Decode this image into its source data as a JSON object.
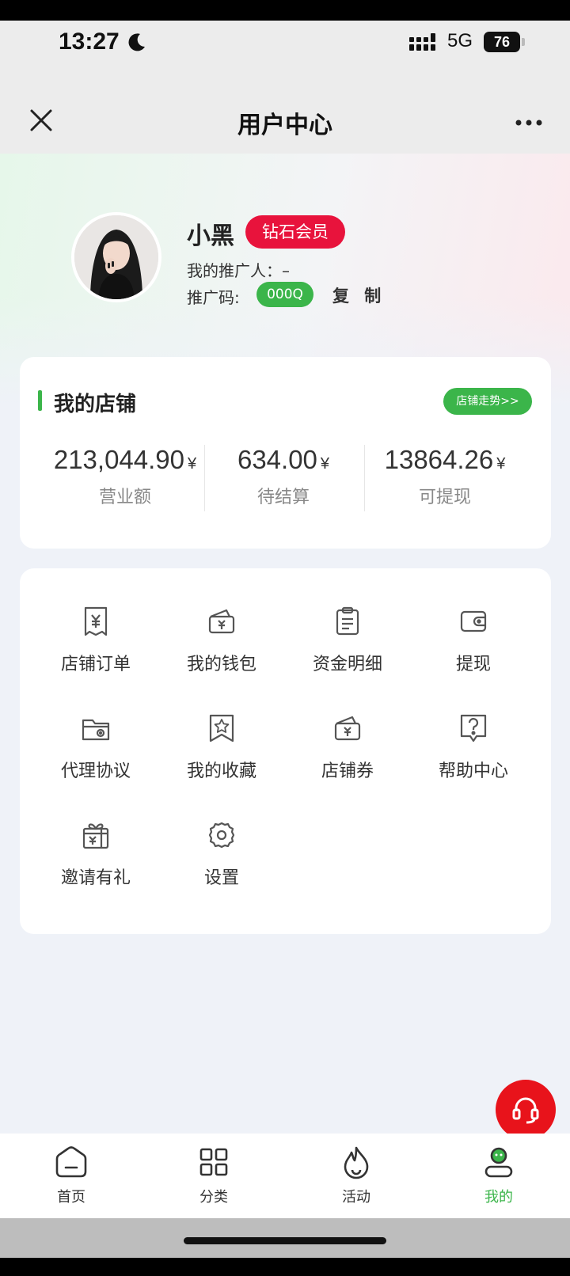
{
  "status_bar": {
    "time": "13:27",
    "network": "5G",
    "battery": "76"
  },
  "nav": {
    "title": "用户中心"
  },
  "profile": {
    "name": "小黑",
    "badge": "钻石会员",
    "promoter_label": "我的推广人：–",
    "promo_code_label": "推广码:",
    "promo_code": "000Q",
    "copy_label": "复 制"
  },
  "shop": {
    "title": "我的店铺",
    "trend_button": "店铺走势>>",
    "stats": [
      {
        "value": "213,044.90",
        "unit": "¥",
        "label": "营业额"
      },
      {
        "value": "634.00",
        "unit": "¥",
        "label": "待结算"
      },
      {
        "value": "13864.26",
        "unit": "¥",
        "label": "可提现"
      }
    ]
  },
  "menu": {
    "items": [
      {
        "label": "店铺订单",
        "icon": "receipt-yen-icon"
      },
      {
        "label": "我的钱包",
        "icon": "wallet-yen-icon"
      },
      {
        "label": "资金明细",
        "icon": "clipboard-icon"
      },
      {
        "label": "提现",
        "icon": "wallet-icon"
      },
      {
        "label": "代理协议",
        "icon": "folder-icon"
      },
      {
        "label": "我的收藏",
        "icon": "star-bookmark-icon"
      },
      {
        "label": "店铺券",
        "icon": "coupon-icon"
      },
      {
        "label": "帮助中心",
        "icon": "help-icon"
      },
      {
        "label": "邀请有礼",
        "icon": "gift-icon"
      },
      {
        "label": "设置",
        "icon": "gear-icon"
      }
    ]
  },
  "tabbar": {
    "tabs": [
      {
        "label": "首页",
        "icon": "home-icon",
        "active": false
      },
      {
        "label": "分类",
        "icon": "grid-icon",
        "active": false
      },
      {
        "label": "活动",
        "icon": "flame-icon",
        "active": false
      },
      {
        "label": "我的",
        "icon": "user-icon",
        "active": true
      }
    ]
  },
  "colors": {
    "accent": "#3bb54a",
    "badge": "#e8133c",
    "fab": "#e8131b"
  }
}
